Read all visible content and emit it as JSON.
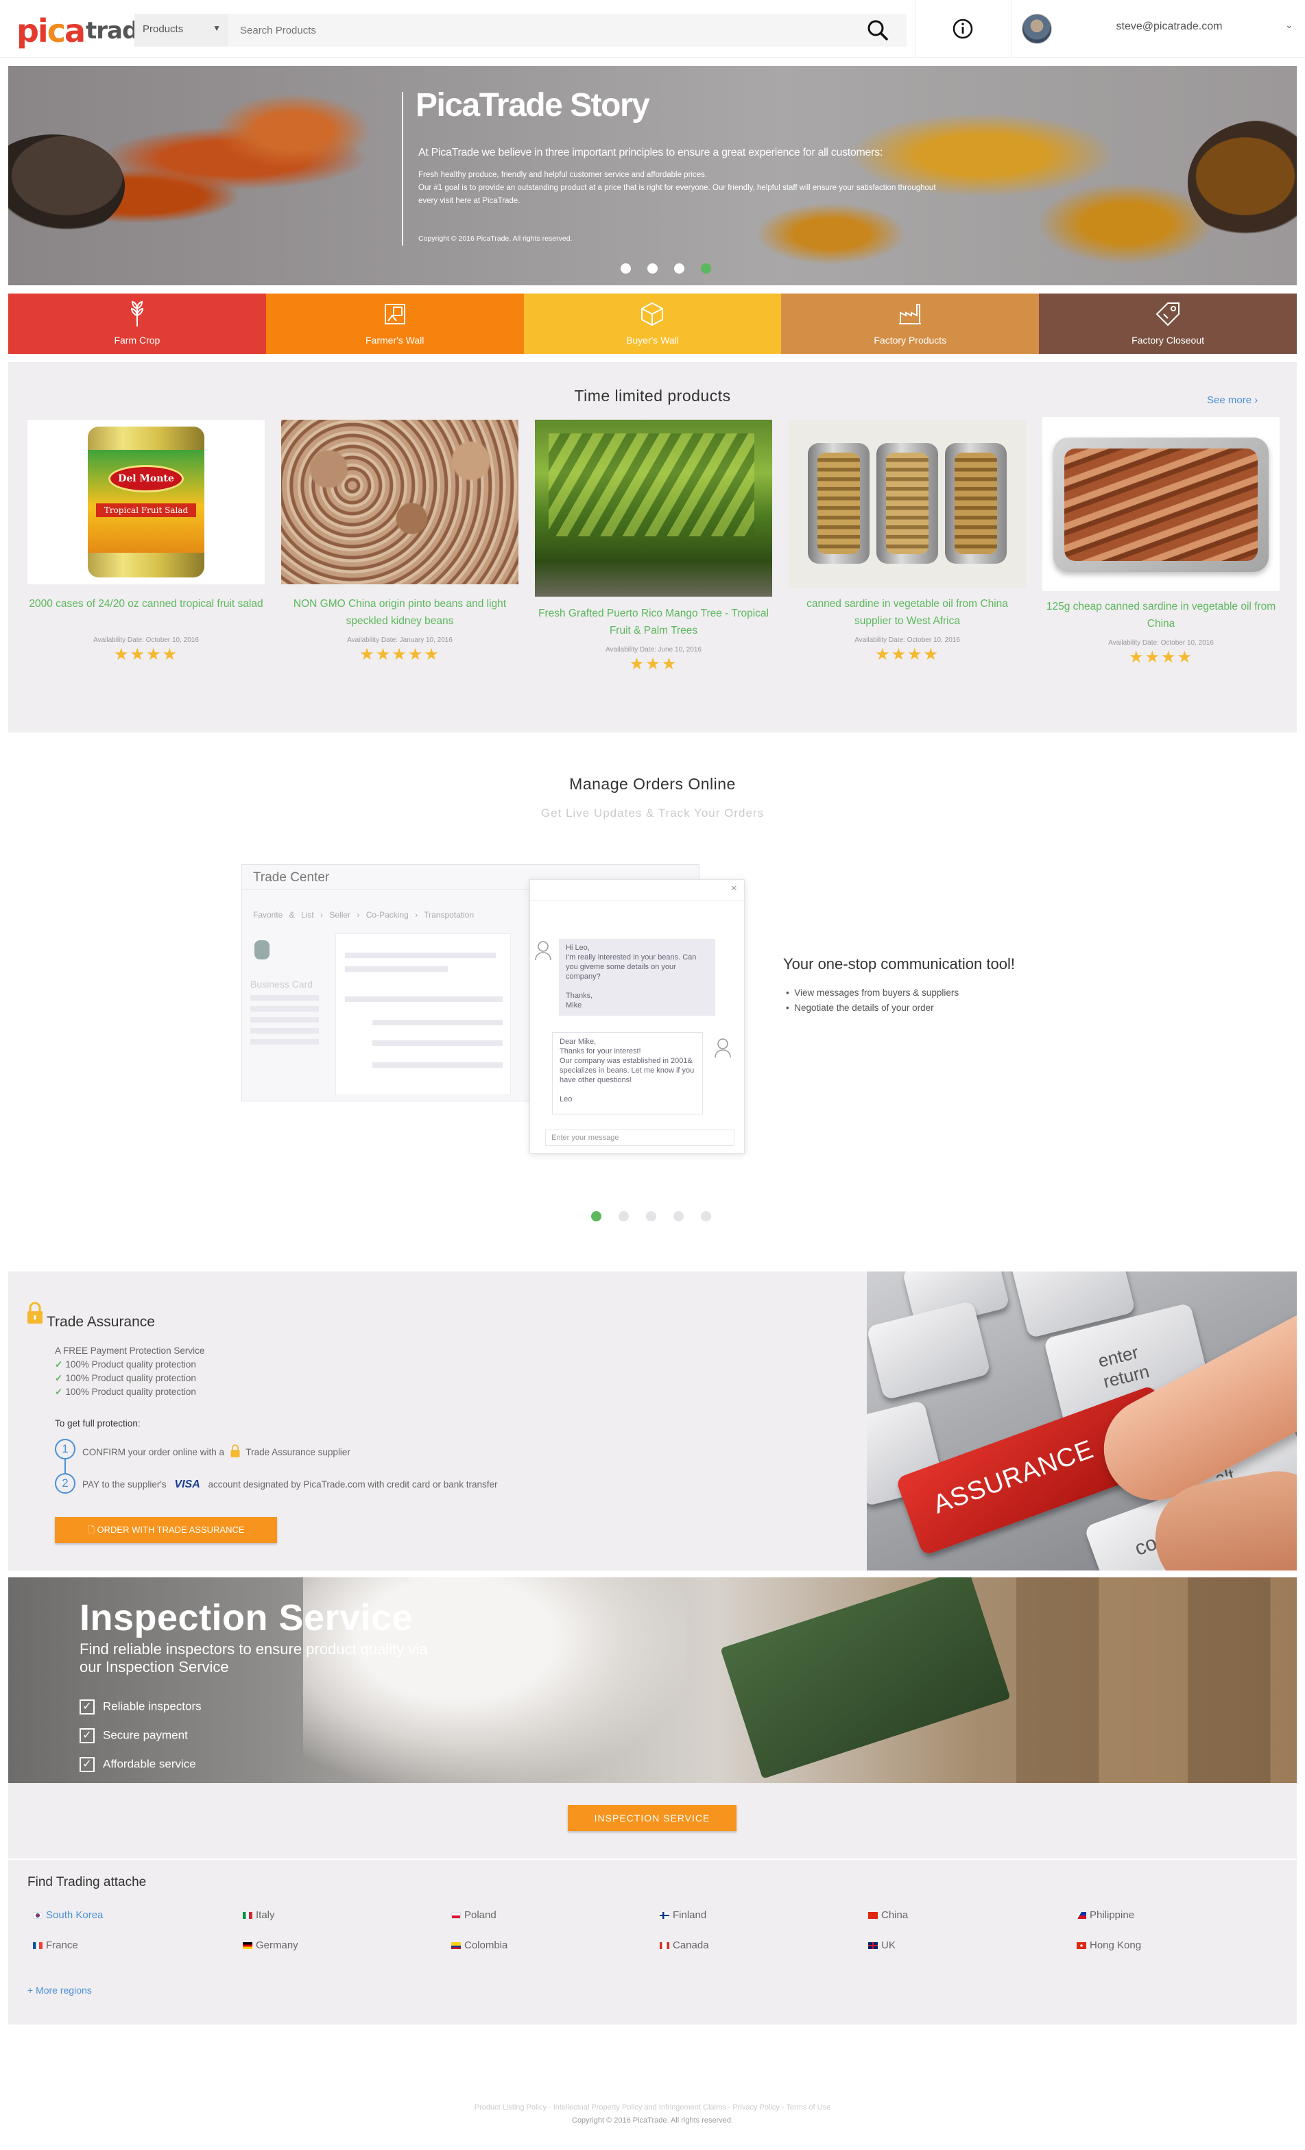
{
  "header": {
    "logo": "picatrade",
    "category_select": "Products",
    "search_placeholder": "Search Products",
    "user_email": "steve@picatrade.com"
  },
  "hero": {
    "title": "PicaTrade Story",
    "lead": "At PicaTrade we believe in three important principles to ensure a great experience for all customers:",
    "text1": "Fresh healthy produce, friendly and helpful  customer service and affordable prices.",
    "text2": "Our #1 goal is to provide an outstanding product at a price that is right for everyone. Our friendly, helpful staff will ensure your satisfaction throughout every visit here at PicaTrade.",
    "copyright": "Copyright © 2016 PicaTrade. All rights reserved.",
    "slides": 4,
    "active_slide": 4
  },
  "categories": [
    {
      "label": "Farm Crop",
      "color": "#e23d35",
      "icon": "wheat-icon"
    },
    {
      "label": "Farmer's Wall",
      "color": "#f7830f",
      "icon": "wall-poster-icon"
    },
    {
      "label": "Buyer's Wall",
      "color": "#f9be2c",
      "icon": "box-icon"
    },
    {
      "label": "Factory Products",
      "color": "#d48f47",
      "icon": "factory-icon"
    },
    {
      "label": "Factory Closeout",
      "color": "#7a5140",
      "icon": "tag-icon"
    }
  ],
  "time_limited": {
    "title": "Time limited products",
    "see_more": "See more ›",
    "products": [
      {
        "name": "2000 cases of 24/20 oz canned tropical fruit salad",
        "date": "Availability Date: October 10, 2016",
        "rating": 4,
        "stars": "★★★★",
        "label1": "Del Monte",
        "label2": "Tropical Fruit Salad"
      },
      {
        "name": "NON GMO China origin pinto beans and light speckled kidney beans",
        "date": "Availability Date: January 10, 2016",
        "rating": 5,
        "stars": "★★★★★"
      },
      {
        "name": "Fresh Grafted Puerto Rico Mango Tree - Tropical Fruit & Palm Trees",
        "date": "Availability Date: June 10, 2016",
        "rating": 3,
        "stars": "★★★"
      },
      {
        "name": "canned sardine in vegetable oil from China supplier to West Africa",
        "date": "Availability Date: October 10, 2016",
        "rating": 4,
        "stars": "★★★★"
      },
      {
        "name": "125g cheap canned sardine in vegetable oil from China",
        "date": "Availability Date: October 10, 2016",
        "rating": 4,
        "stars": "★★★★"
      }
    ]
  },
  "manage_orders": {
    "title": "Manage Orders Online",
    "subtitle": "Get Live Updates & Track Your Orders",
    "trade_center": "Trade Center",
    "tc_nav": [
      "Favorite & List",
      "Seller",
      "Co-Packing",
      "Transpotation"
    ],
    "business_card": "Business Card",
    "chat_msg1": "Hi Leo,\nI'm really interested in your beans. Can you giveme some details on your company?\n\nThanks,\nMike",
    "chat_msg2": "Dear Mike,\nThanks for your interest!\nOur company was established in 2001& specializes in beans. Let me know if you have other questions!\n\nLeo",
    "chat_placeholder": "Enter your message",
    "tool_title": "Your one-stop communication tool!",
    "tool_items": [
      "View messages from buyers & suppliers",
      "Negotiate the details of your order"
    ],
    "slides": 5,
    "active_slide": 1
  },
  "trade_assurance": {
    "title": "Trade Assurance",
    "free_service": "A FREE Payment Protection Service",
    "protections": [
      "100% Product quality protection",
      "100% Product quality protection",
      "100% Product quality protection"
    ],
    "get_full": "To get full protection:",
    "step1_num": "1",
    "step1": "CONFIRM your order online with a",
    "step1_tail": "Trade Assurance supplier",
    "step2_num": "2",
    "step2": "PAY to the supplier's",
    "visa": "VISA",
    "step2_tail": "account designated by PicaTrade.com with credit card or bank transfer",
    "button": "ORDER WITH TRADE ASSURANCE",
    "image_keys": [
      "enter",
      "return",
      "ASSURANCE",
      "alt",
      "control"
    ]
  },
  "inspection": {
    "title": "Inspection Service",
    "subtitle": "Find reliable inspectors to ensure product quality via our Inspection Service",
    "items": [
      "Reliable inspectors",
      "Secure payment",
      "Affordable service"
    ],
    "button": "INSPECTION SERVICE"
  },
  "trading_attache": {
    "title": "Find Trading attache",
    "regions": [
      {
        "name": "South Korea",
        "highlight": true
      },
      {
        "name": "Italy"
      },
      {
        "name": "Poland"
      },
      {
        "name": "Finland"
      },
      {
        "name": "China"
      },
      {
        "name": "Philippine"
      },
      {
        "name": "France"
      },
      {
        "name": "Germany"
      },
      {
        "name": "Colombia"
      },
      {
        "name": "Canada"
      },
      {
        "name": "UK"
      },
      {
        "name": "Hong Kong"
      }
    ],
    "more": "+ More regions"
  },
  "footer": {
    "links": "Product Listing Policy - Intellectual Property Policy and Infringement Claims - Privacy Policy - Terms of Use",
    "copyright": "Copyright © 2016 PicaTrade. All rights reserved."
  },
  "colors": {
    "accent_orange": "#f7941d",
    "green": "#5bb85d",
    "link_blue": "#4a90d9"
  }
}
